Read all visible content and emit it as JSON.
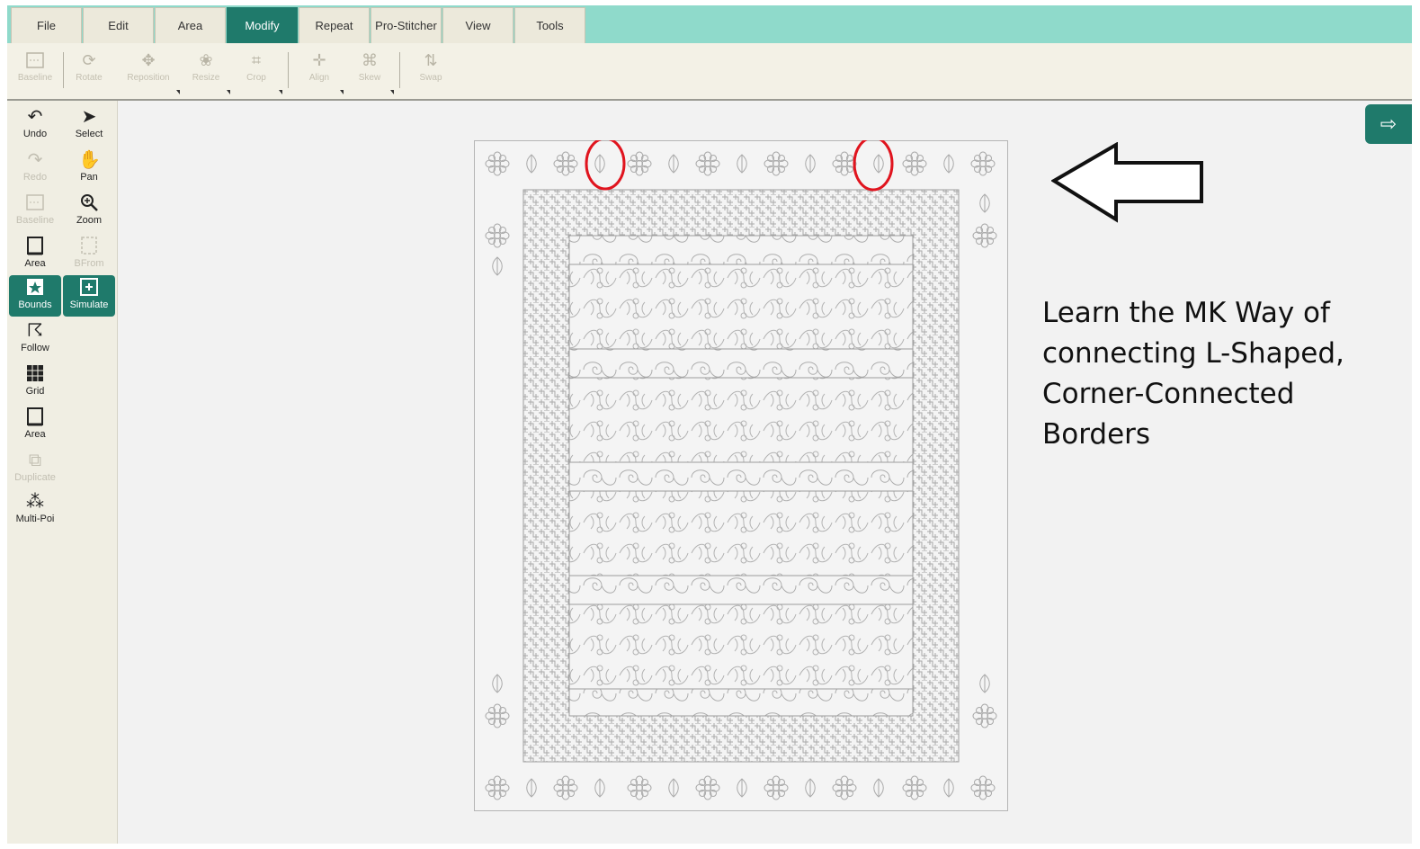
{
  "menu": {
    "tabs": [
      {
        "label": "File"
      },
      {
        "label": "Edit"
      },
      {
        "label": "Area"
      },
      {
        "label": "Modify",
        "active": true
      },
      {
        "label": "Repeat"
      },
      {
        "label": "Pro-Stitcher"
      },
      {
        "label": "View"
      },
      {
        "label": "Tools"
      }
    ]
  },
  "toolbar": {
    "baseline": {
      "label": "Baseline",
      "icon": "baseline-icon"
    },
    "rotate": {
      "label": "Rotate",
      "icon": "rotate-icon"
    },
    "reposition": {
      "label": "Reposition",
      "icon": "reposition-icon"
    },
    "resize": {
      "label": "Resize",
      "icon": "resize-icon"
    },
    "crop": {
      "label": "Crop",
      "icon": "crop-icon"
    },
    "align": {
      "label": "Align",
      "icon": "align-icon"
    },
    "skew": {
      "label": "Skew",
      "icon": "skew-icon"
    },
    "swap": {
      "label": "Swap",
      "icon": "swap-icon"
    }
  },
  "left_tools": {
    "undo": {
      "label": "Undo",
      "icon": "undo-icon"
    },
    "select": {
      "label": "Select",
      "icon": "select-icon"
    },
    "redo": {
      "label": "Redo",
      "icon": "redo-icon"
    },
    "pan": {
      "label": "Pan",
      "icon": "pan-hand-icon"
    },
    "baseline": {
      "label": "Baseline",
      "icon": "baseline-icon"
    },
    "zoom": {
      "label": "Zoom",
      "icon": "zoom-icon"
    },
    "area": {
      "label": "Area",
      "icon": "area-icon"
    },
    "bfrom": {
      "label": "BFrom",
      "icon": "bfrom-icon"
    },
    "bounds": {
      "label": "Bounds",
      "icon": "bounds-icon"
    },
    "simulate": {
      "label": "Simulate",
      "icon": "simulate-icon"
    },
    "follow": {
      "label": "Follow",
      "icon": "follow-icon"
    },
    "grid": {
      "label": "Grid",
      "icon": "grid-icon"
    },
    "area2": {
      "label": "Area",
      "icon": "area-icon"
    },
    "duplicate": {
      "label": "Duplicate",
      "icon": "duplicate-icon"
    },
    "multipoint": {
      "label": "Multi-Poi",
      "icon": "multi-point-icon"
    }
  },
  "annotation": {
    "text_lines": [
      "Learn the MK Way of",
      "connecting L-Shaped,",
      "Corner-Connected",
      "Borders"
    ],
    "arrow_direction": "left",
    "highlight_color": "#e0141e",
    "highlight_count": 2
  },
  "colors": {
    "accent": "#1f7a6b",
    "menubar": "#8fdacb",
    "highlight": "#e0141e"
  }
}
